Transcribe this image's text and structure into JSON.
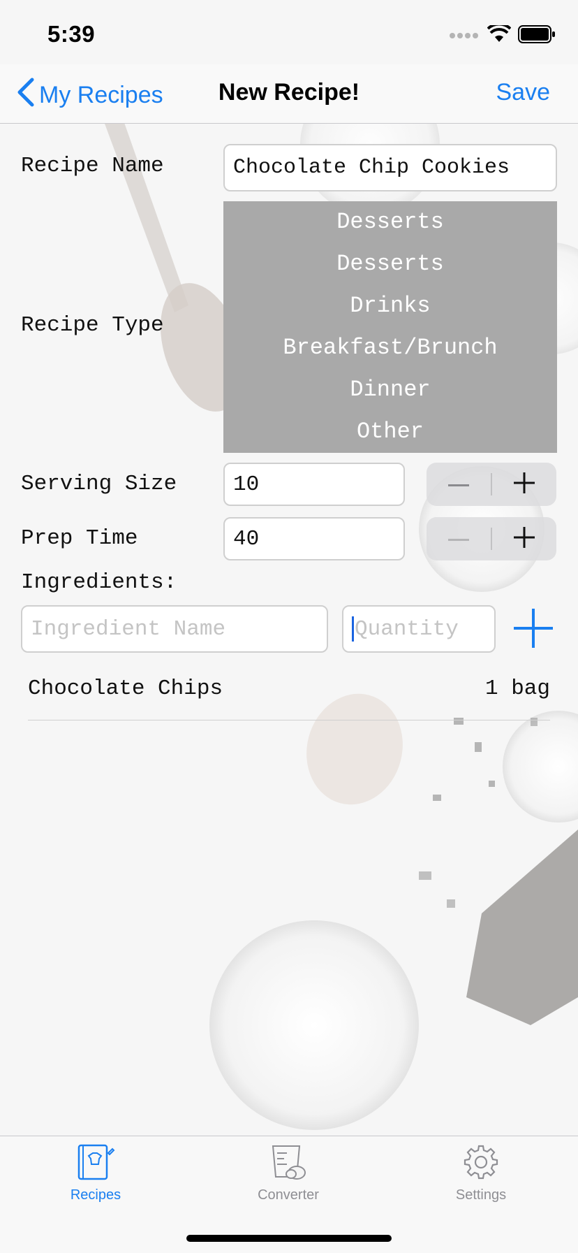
{
  "status": {
    "time": "5:39"
  },
  "nav": {
    "back_label": "My Recipes",
    "title": "New Recipe!",
    "save_label": "Save"
  },
  "form": {
    "recipe_name_label": "Recipe Name",
    "recipe_name_value": "Chocolate Chip Cookies",
    "recipe_type_label": "Recipe Type",
    "recipe_type_options": [
      "Desserts",
      "Desserts",
      "Drinks",
      "Breakfast/Brunch",
      "Dinner",
      "Other"
    ],
    "serving_size_label": "Serving Size",
    "serving_size_value": "10",
    "prep_time_label": "Prep Time",
    "prep_time_value": "40",
    "ingredients_label": "Ingredients:",
    "ingredient_name_placeholder": "Ingredient Name",
    "quantity_placeholder": "Quantity"
  },
  "ingredients": [
    {
      "name": "Chocolate Chips",
      "quantity": "1 bag"
    }
  ],
  "tabs": [
    {
      "label": "Recipes",
      "icon": "recipe-book-icon",
      "active": true
    },
    {
      "label": "Converter",
      "icon": "measuring-cup-icon",
      "active": false
    },
    {
      "label": "Settings",
      "icon": "gear-icon",
      "active": false
    }
  ],
  "colors": {
    "accent": "#1a7ff0",
    "inactive": "#8e8e93",
    "picker_bg": "#a9a9a9"
  }
}
